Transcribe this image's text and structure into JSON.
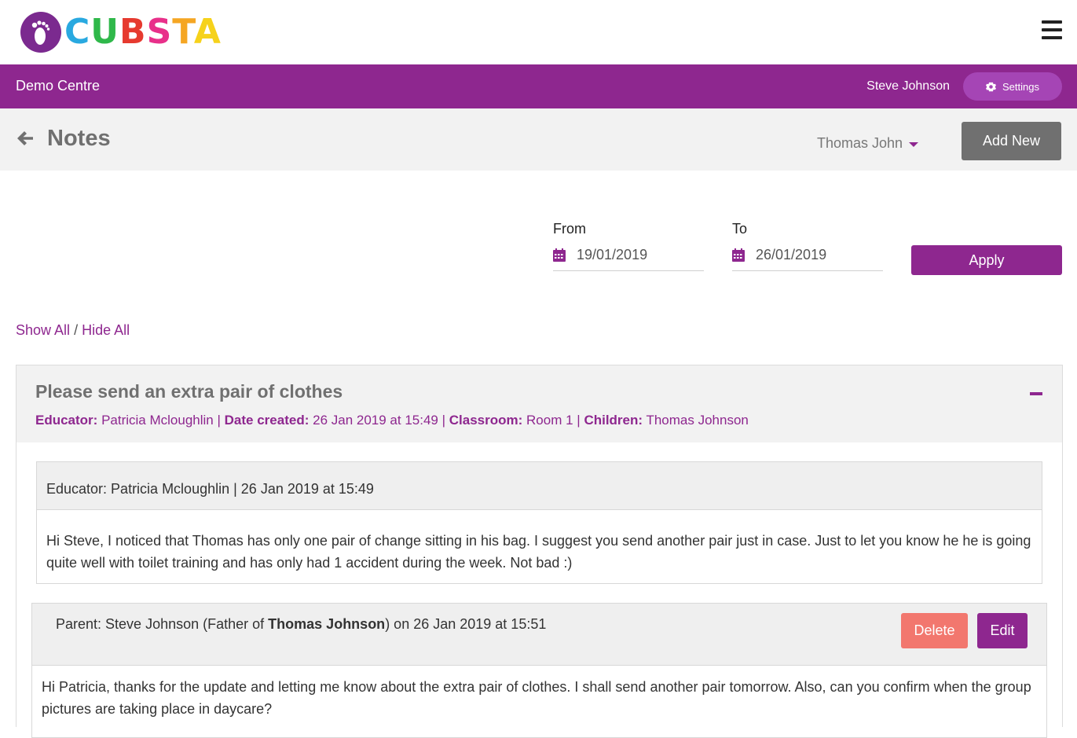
{
  "brand": {
    "logo_letters": [
      {
        "char": "C",
        "color": "#29a9e0"
      },
      {
        "char": "U",
        "color": "#2fb84a"
      },
      {
        "char": "B",
        "color": "#e63a2f"
      },
      {
        "char": "S",
        "color": "#e8308a"
      },
      {
        "char": "T",
        "color": "#f5a623"
      },
      {
        "char": "A",
        "color": "#f6d21b"
      }
    ],
    "accent": "#8e278f"
  },
  "header": {
    "centre_name": "Demo Centre",
    "user_name": "Steve Johnson",
    "settings_label": "Settings"
  },
  "titlebar": {
    "title": "Notes",
    "child_selected": "Thomas John",
    "add_new_label": "Add New"
  },
  "filter": {
    "from_label": "From",
    "from_value": "19/01/2019",
    "to_label": "To",
    "to_value": "26/01/2019",
    "apply_label": "Apply"
  },
  "toggle": {
    "show_all": "Show All",
    "separator": "/",
    "hide_all": "Hide All"
  },
  "note": {
    "title": "Please send an extra pair of clothes",
    "educator_label": "Educator:",
    "educator": "Patricia Mcloughlin",
    "date_label": "Date created:",
    "date": "26 Jan 2019 at 15:49",
    "classroom_label": "Classroom:",
    "classroom": "Room 1",
    "children_label": "Children:",
    "children": "Thomas Johnson",
    "sep": "|",
    "messages": [
      {
        "header": "Educator: Patricia Mcloughlin | 26 Jan 2019 at 15:49",
        "body": "Hi Steve, I noticed that Thomas has only one pair of change sitting in his bag. I suggest you send another pair just in case. Just to let you know he he is going quite well with toilet training and has only had 1 accident during the week. Not bad :)"
      }
    ],
    "reply": {
      "prefix": "Parent: Steve Johnson (Father of",
      "child": "Thomas Johnson",
      "suffix": ") on 26 Jan 2019 at 15:51",
      "delete_label": "Delete",
      "edit_label": "Edit",
      "body": "Hi Patricia, thanks for the update and letting me know about the extra pair of clothes. I shall send another pair tomorrow. Also, can you confirm when the group pictures are taking place in daycare?"
    }
  }
}
